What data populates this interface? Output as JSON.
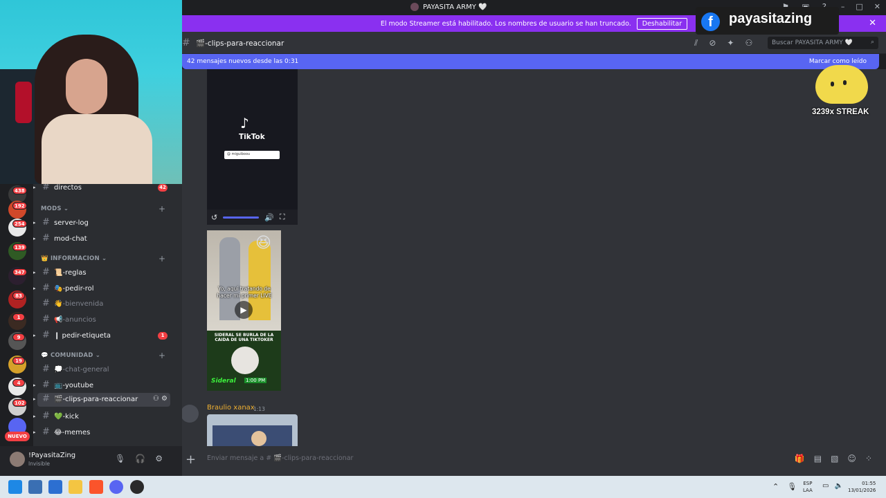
{
  "window": {
    "title": "PAYASITA ARMY 🤍"
  },
  "streamer_banner": {
    "text": "El modo Streamer está habilitado. Los nombres de usuario se han truncado.",
    "button": "Deshabilitar"
  },
  "channel_header": {
    "name": "🎬-clips-para-reaccionar",
    "search_placeholder": "Buscar PAYASITA ARMY 🤍"
  },
  "new_messages": {
    "text": "42 mensajes nuevos desde las 0:31",
    "mark": "Marcar como leído"
  },
  "overlay": {
    "handle": "payasitazing",
    "streak": "3239x STREAK"
  },
  "tiktok_embed": {
    "brand": "TikTok",
    "search": "@ miguiboou"
  },
  "video_clip": {
    "caption_top": "Yo, aquí tratando de hacer mi primer LIVE",
    "caption_bottom": "SIDERAL SE BURLA DE LA CAIDA DE UNA TIKTOKER",
    "name": "Sideral",
    "time": "1:00 PM"
  },
  "message": {
    "author": "Braulio xanax",
    "time": "1:13"
  },
  "composer": {
    "placeholder": "Enviar mensaje a # 🎬-clips-para-reaccionar"
  },
  "servers": [
    {
      "badge": "438",
      "color": "#3a3a3a"
    },
    {
      "badge": "192",
      "color": "#d0482a"
    },
    {
      "badge": "254",
      "color": "#e8e8e8"
    },
    {
      "badge": "139",
      "color": "#2f5a24"
    },
    {
      "badge": "347",
      "color": "#2c1f2f"
    },
    {
      "badge": "83",
      "color": "#b02222"
    },
    {
      "badge": "1",
      "color": "#3b2a22"
    },
    {
      "badge": "9",
      "color": "#555"
    },
    {
      "badge": "19",
      "color": "#d6a12a"
    },
    {
      "badge": "4",
      "color": "#e9e9e9"
    },
    {
      "badge": "102",
      "color": "#cfcfcf"
    },
    {
      "badge": "",
      "color": "#5865f2"
    }
  ],
  "new_pill": "NUEVO",
  "channels": {
    "directos": {
      "label": "directos",
      "count": "42"
    },
    "cat_mods": "MODS",
    "server_log": "server-log",
    "mod_chat": "mod-chat",
    "cat_info": "👑 INFORMACION",
    "reglas": "📜-reglas",
    "pedir_rol": "🎭-pedir-rol",
    "bienvenida": "👋-bienvenida",
    "anuncios": "📢-anuncios",
    "pedir_etiqueta": {
      "label": "❙ pedir-etiqueta",
      "count": "1"
    },
    "cat_comunidad": "💬 COMUNIDAD",
    "chat_general": "💭-chat-general",
    "youtube": "📺-youtube",
    "clips": "🎬-clips-para-reaccionar",
    "kick": "💚-kick",
    "memes": "😂-memes"
  },
  "user": {
    "name": "!PayasitaZing",
    "status": "Invisible"
  },
  "taskbar": {
    "lang_top": "ESP",
    "lang_bottom": "LAA",
    "time": "01:55",
    "date": "13/01/2026"
  },
  "colors": {
    "streamer_purple": "#8a30f0",
    "blurple": "#5865f2",
    "mention_red": "#f23f43"
  }
}
